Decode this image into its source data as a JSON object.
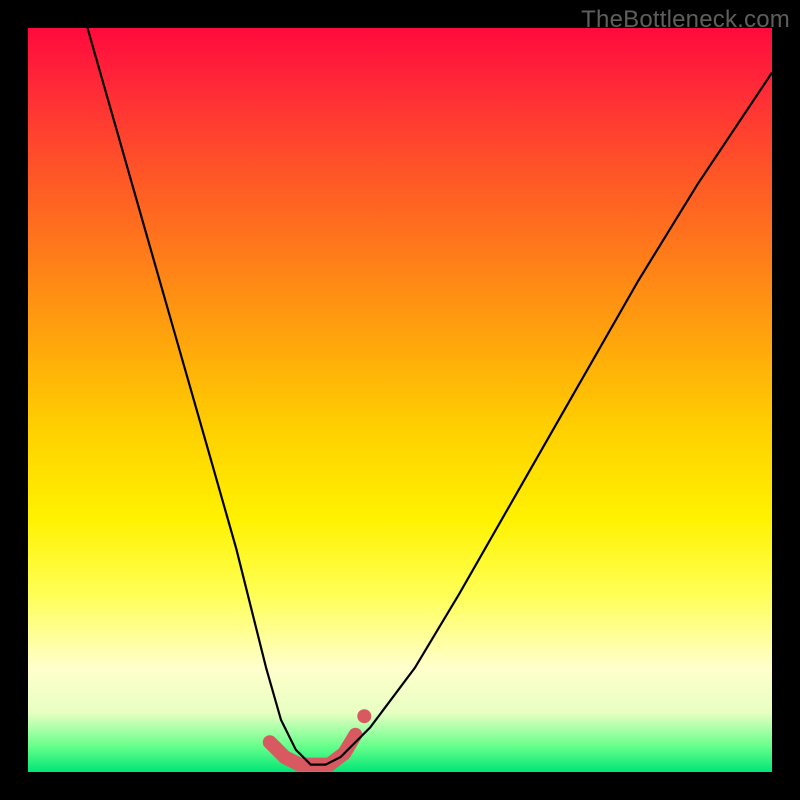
{
  "watermark": "TheBottleneck.com",
  "chart_data": {
    "type": "line",
    "title": "",
    "xlabel": "",
    "ylabel": "",
    "xlim": [
      0,
      100
    ],
    "ylim": [
      0,
      100
    ],
    "grid": false,
    "legend": false,
    "series": [
      {
        "name": "curve",
        "x": [
          8,
          12,
          16,
          20,
          24,
          28,
          30,
          32,
          34,
          36,
          38,
          40,
          42,
          46,
          52,
          58,
          66,
          74,
          82,
          90,
          100
        ],
        "y": [
          100,
          86,
          72,
          58,
          44,
          30,
          22,
          14,
          7,
          3,
          1,
          1,
          2,
          6,
          14,
          24,
          38,
          52,
          66,
          79,
          94
        ]
      }
    ],
    "accent_markers": {
      "name": "bottom-markers",
      "color": "#d85a60",
      "x": [
        32.5,
        34.5,
        36.5,
        38.5,
        40.5,
        42.5,
        44.0
      ],
      "y": [
        4.0,
        2.0,
        1.0,
        1.0,
        1.0,
        2.5,
        5.0
      ]
    }
  }
}
